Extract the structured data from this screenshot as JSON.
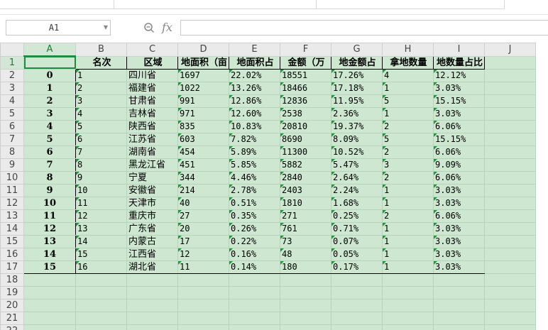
{
  "namebox": {
    "value": "A1",
    "dropdown_icon": "chevron-down-icon"
  },
  "formula_bar": {
    "zoom_icon": "zoom-icon",
    "fx_label": "fx",
    "value": ""
  },
  "columns": [
    "A",
    "B",
    "C",
    "D",
    "E",
    "F",
    "G",
    "H",
    "I",
    "J"
  ],
  "header_row": [
    "",
    "名次",
    "区域",
    "地面积（亩",
    "地面积占",
    "金额（万",
    "地金额占",
    "拿地数量",
    "地数量占比"
  ],
  "rows": [
    [
      "0",
      "1",
      "四川省",
      "1697",
      "22.02%",
      "18551",
      "17.26%",
      "4",
      "12.12%"
    ],
    [
      "1",
      "2",
      "福建省",
      "1022",
      "13.26%",
      "18466",
      "17.18%",
      "1",
      "3.03%"
    ],
    [
      "2",
      "3",
      "甘肃省",
      "991",
      "12.86%",
      "12836",
      "11.95%",
      "5",
      "15.15%"
    ],
    [
      "3",
      "4",
      "吉林省",
      "971",
      "12.60%",
      "2538",
      "2.36%",
      "1",
      "3.03%"
    ],
    [
      "4",
      "5",
      "陕西省",
      "835",
      "10.83%",
      "20810",
      "19.37%",
      "2",
      "6.06%"
    ],
    [
      "5",
      "6",
      "江苏省",
      "603",
      "7.82%",
      "8690",
      "8.09%",
      "5",
      "15.15%"
    ],
    [
      "6",
      "7",
      "湖南省",
      "454",
      "5.89%",
      "11300",
      "10.52%",
      "2",
      "6.06%"
    ],
    [
      "7",
      "8",
      "黑龙江省",
      "451",
      "5.85%",
      "5882",
      "5.47%",
      "3",
      "9.09%"
    ],
    [
      "8",
      "9",
      "宁夏",
      "344",
      "4.46%",
      "2840",
      "2.64%",
      "2",
      "6.06%"
    ],
    [
      "9",
      "10",
      "安徽省",
      "214",
      "2.78%",
      "2403",
      "2.24%",
      "1",
      "3.03%"
    ],
    [
      "10",
      "11",
      "天津市",
      "40",
      "0.51%",
      "1810",
      "1.68%",
      "1",
      "3.03%"
    ],
    [
      "11",
      "12",
      "重庆市",
      "27",
      "0.35%",
      "271",
      "0.25%",
      "2",
      "6.06%"
    ],
    [
      "12",
      "13",
      "广东省",
      "20",
      "0.26%",
      "761",
      "0.71%",
      "1",
      "3.03%"
    ],
    [
      "13",
      "14",
      "内蒙古",
      "17",
      "0.22%",
      "73",
      "0.07%",
      "1",
      "3.03%"
    ],
    [
      "14",
      "15",
      "江西省",
      "12",
      "0.16%",
      "48",
      "0.05%",
      "1",
      "3.03%"
    ],
    [
      "15",
      "16",
      "湖北省",
      "11",
      "0.14%",
      "180",
      "0.17%",
      "1",
      "3.03%"
    ]
  ],
  "empty_row_numbers": [
    "18",
    "19",
    "20",
    "21",
    "22"
  ],
  "colors": {
    "sheet_bg": "#cde7d0",
    "selection": "#1e8a42",
    "comment_marker": "#1c9a3a"
  }
}
